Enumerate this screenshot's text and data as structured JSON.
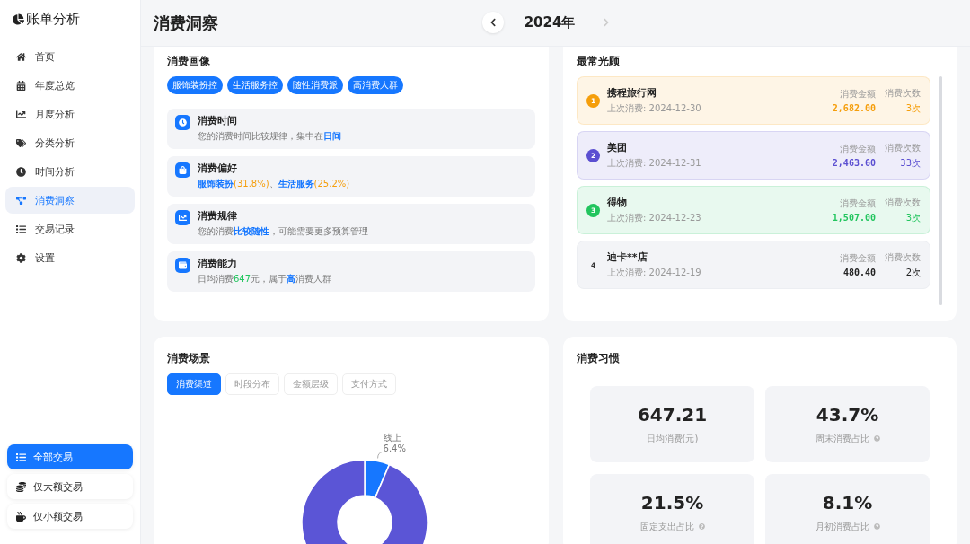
{
  "app": {
    "title": "账单分析"
  },
  "sidebar": {
    "items": [
      {
        "label": "首页",
        "selected": false
      },
      {
        "label": "年度总览",
        "selected": false
      },
      {
        "label": "月度分析",
        "selected": false
      },
      {
        "label": "分类分析",
        "selected": false
      },
      {
        "label": "时间分析",
        "selected": false
      },
      {
        "label": "消费洞察",
        "selected": true
      },
      {
        "label": "交易记录",
        "selected": false
      },
      {
        "label": "设置",
        "selected": false
      }
    ],
    "filters": [
      {
        "label": "全部交易",
        "selected": true
      },
      {
        "label": "仅大额交易",
        "selected": false
      },
      {
        "label": "仅小额交易",
        "selected": false
      }
    ]
  },
  "header": {
    "title": "消费洞察",
    "year": "2024年",
    "prev_disabled": false,
    "next_disabled": true
  },
  "profile": {
    "title": "消费画像",
    "tags": [
      "服饰装扮控",
      "生活服务控",
      "随性消费派",
      "高消费人群"
    ],
    "insights": [
      {
        "title": "消费时间",
        "text": [
          {
            "text": "您的消费时间比较规律，集中在",
            "kind": "plain"
          },
          {
            "text": "日间",
            "kind": "highlight"
          }
        ]
      },
      {
        "title": "消费偏好",
        "text": [
          {
            "text": "服饰装扮",
            "kind": "highlight"
          },
          {
            "text": "(31.8%)",
            "kind": "percent"
          },
          {
            "text": "、",
            "kind": "plain"
          },
          {
            "text": "生活服务",
            "kind": "highlight"
          },
          {
            "text": "(25.2%)",
            "kind": "percent"
          }
        ]
      },
      {
        "title": "消费规律",
        "text": [
          {
            "text": "您的消费",
            "kind": "plain"
          },
          {
            "text": "比较随性",
            "kind": "highlight"
          },
          {
            "text": "，可能需要更多预算管理",
            "kind": "plain"
          }
        ]
      },
      {
        "title": "消费能力",
        "text": [
          {
            "text": "日均消费",
            "kind": "plain"
          },
          {
            "text": "647",
            "kind": "amount"
          },
          {
            "text": "元，属于",
            "kind": "plain"
          },
          {
            "text": "高",
            "kind": "highlight"
          },
          {
            "text": "消费人群",
            "kind": "plain"
          }
        ]
      }
    ]
  },
  "frequent": {
    "title": "最常光顾",
    "items": [
      {
        "rank": "1",
        "name": "携程旅行网",
        "last": "上次消费: 2024-12-30",
        "amount_label": "消费金额",
        "amount": "2,682.00",
        "count_label": "消费次数",
        "count": "3次",
        "color": "#f59e0b"
      },
      {
        "rank": "2",
        "name": "美团",
        "last": "上次消费: 2024-12-31",
        "amount_label": "消费金额",
        "amount": "2,463.60",
        "count_label": "消费次数",
        "count": "33次",
        "color": "#5b4fd1"
      },
      {
        "rank": "3",
        "name": "得物",
        "last": "上次消费: 2024-12-23",
        "amount_label": "消费金额",
        "amount": "1,507.00",
        "count_label": "消费次数",
        "count": "3次",
        "color": "#22c55e"
      },
      {
        "rank": "4",
        "name": "迪卡**店",
        "last": "上次消费: 2024-12-19",
        "amount_label": "消费金额",
        "amount": "480.40",
        "count_label": "消费次数",
        "count": "2次"
      }
    ]
  },
  "scene": {
    "title": "消费场景",
    "tabs": [
      {
        "label": "消费渠道",
        "selected": true
      },
      {
        "label": "时段分布",
        "selected": false
      },
      {
        "label": "金额层级",
        "selected": false
      },
      {
        "label": "支付方式",
        "selected": false
      }
    ],
    "chart_data": {
      "type": "donut",
      "categories": [
        "线上",
        null
      ],
      "values": [
        6.4,
        93.6
      ],
      "value_labels": [
        "6.4%",
        null
      ]
    }
  },
  "habits": {
    "title": "消费习惯",
    "stats": [
      {
        "value": "647.21",
        "label": "日均消费(元)",
        "info": false
      },
      {
        "value": "43.7%",
        "label": "周末消费占比",
        "info": true
      },
      {
        "value": "21.5%",
        "label": "固定支出占比",
        "info": true
      },
      {
        "value": "8.1%",
        "label": "月初消费占比",
        "info": true
      }
    ]
  }
}
